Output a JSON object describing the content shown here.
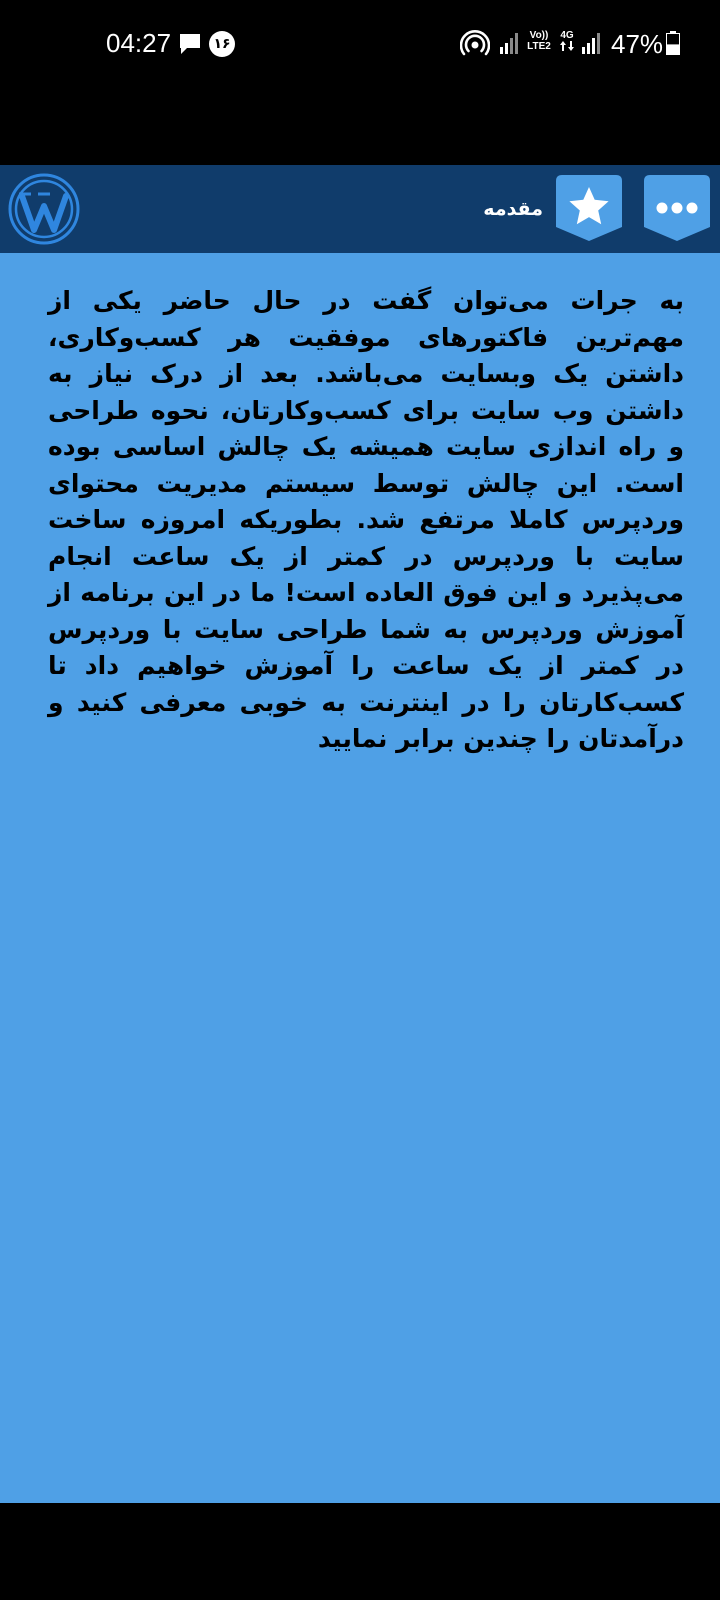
{
  "status_bar": {
    "time": "04:27",
    "notification_count": "۱۶",
    "volte_label_1": "Vo))",
    "volte_label_2": "LTE2",
    "network_type": "4G",
    "battery_percent": "47%",
    "icons": [
      "message-icon",
      "hotspot-icon",
      "signal-icon",
      "signal-icon",
      "battery-icon"
    ],
    "battery_level": 0.47
  },
  "toolbar": {
    "title": "مقدمه",
    "logo": "wordpress-logo",
    "favorite_icon": "star-icon",
    "menu_icon": "more-dots-icon",
    "colors": {
      "bar": "#103c6b",
      "button": "#4fa0e6"
    }
  },
  "content": {
    "text": "به جرات می‌توان گفت در حال حاضر یکی از مهم‌ترین فاکتورهای موفقیت هر کسب‌وکاری، داشتن یک وبسایت می‌باشد. بعد از درک نیاز به داشتن وب سایت برای کسب‌وکارتان، نحوه طراحی و راه اندازی سایت همیشه یک چالش اساسی بوده است. این چالش توسط سیستم مدیریت محتوای وردپرس کاملا مرتفع شد. بطوریکه امروزه ساخت سایت با وردپرس در کمتر از یک ساعت انجام می‌پذیرد و این فوق العاده است! ما در این برنامه از آموزش وردپرس به شما طراحی سایت با وردپرس در کمتر از یک ساعت را آموزش خواهیم داد تا کسب‌کارتان را در اینترنت به خوبی معرفی کنید و درآمدتان را چندین برابر نمایید",
    "background": "#4fa0e6"
  }
}
